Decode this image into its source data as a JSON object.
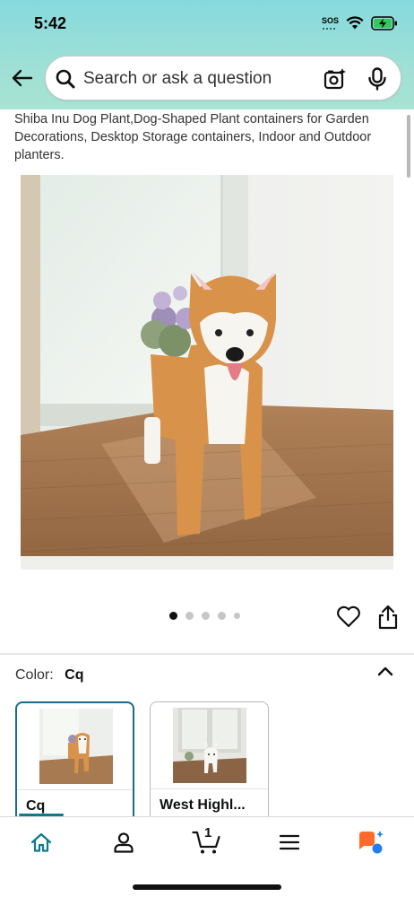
{
  "status_bar": {
    "time": "5:42",
    "sos_label": "SOS"
  },
  "search": {
    "placeholder": "Search or ask a question"
  },
  "product": {
    "title": "Shiba Inu Dog Plant,Dog-Shaped Plant containers for Garden Decorations, Desktop Storage containers, Indoor and Outdoor planters.",
    "image_count": 5,
    "active_image_index": 0
  },
  "color_selector": {
    "label": "Color:",
    "selected_value": "Cq",
    "options": [
      {
        "label": "Cq",
        "selected": true
      },
      {
        "label": "West Highl...",
        "selected": false
      }
    ]
  },
  "bottom_nav": {
    "cart_count": "1",
    "items": [
      "home-icon",
      "account-icon",
      "cart-icon",
      "menu-icon",
      "rufus-icon"
    ]
  },
  "colors": {
    "accent": "#0e7a8a",
    "header_gradient_top": "#85d9dc",
    "header_gradient_bottom": "#a8e3d2",
    "shiba_orange": "#d9924a",
    "ai_orange": "#ff6a2b",
    "ai_blue": "#1f7ff0"
  }
}
